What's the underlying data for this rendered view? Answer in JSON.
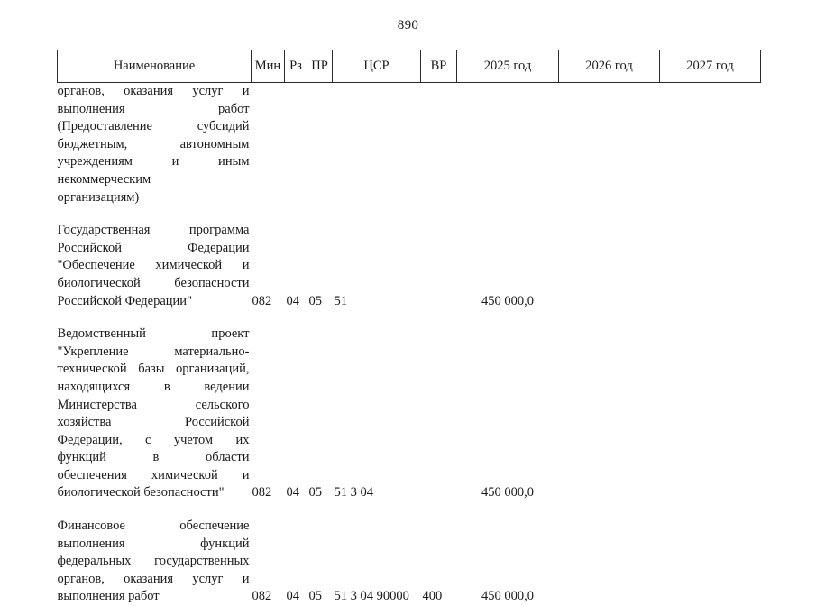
{
  "page": {
    "number": "890"
  },
  "table": {
    "headers": [
      {
        "key": "name",
        "label": "Наименование"
      },
      {
        "key": "min",
        "label": "Мин"
      },
      {
        "key": "rz",
        "label": "Рз"
      },
      {
        "key": "pr",
        "label": "ПР"
      },
      {
        "key": "csr",
        "label": "ЦСР"
      },
      {
        "key": "vr",
        "label": "ВР"
      },
      {
        "key": "y2025",
        "label": "2025 год"
      },
      {
        "key": "y2026",
        "label": "2026 год"
      },
      {
        "key": "y2027",
        "label": "2027 год"
      }
    ],
    "rows": [
      {
        "id": "row-continuation-subsidies",
        "name_lines": [
          "органов, оказания услуг и",
          "выполнения работ",
          "(Предоставление субсидий",
          "бюджетным, автономным",
          "учреждениям и иным",
          "некоммерческим",
          "организациям)"
        ],
        "name_full": "органов, оказания услуг и выполнения работ (Предоставление субсидий бюджетным, автономным учреждениям и иным некоммерческим организациям)",
        "min": "",
        "rz": "",
        "pr": "",
        "csr": "",
        "vr": "",
        "y2025": "",
        "y2026": "",
        "y2027": ""
      },
      {
        "id": "row-state-program-chem-bio-safety",
        "name_lines": [
          "Государственная программа",
          "Российской Федерации",
          "\"Обеспечение химической и",
          "биологической безопасности",
          "Российской Федерации\""
        ],
        "name_full": "Государственная программа Российской Федерации \"Обеспечение химической и биологической безопасности Российской Федерации\"",
        "min": "082",
        "rz": "04",
        "pr": "05",
        "csr": "51",
        "vr": "",
        "y2025": "450 000,0",
        "y2026": "",
        "y2027": ""
      },
      {
        "id": "row-departmental-project-material-base",
        "name_lines": [
          "Ведомственный проект",
          "\"Укрепление материально-",
          "технической базы организаций,",
          "находящихся в ведении",
          "Министерства сельского",
          "хозяйства Российской",
          "Федерации, с учетом их",
          "функций в области",
          "обеспечения химической и",
          "биологической безопасности\""
        ],
        "name_full": "Ведомственный проект \"Укрепление материально-технической базы организаций, находящихся в ведении Министерства сельского хозяйства Российской Федерации, с учетом их функций в области обеспечения химической и биологической безопасности\"",
        "min": "082",
        "rz": "04",
        "pr": "05",
        "csr": "51 3 04",
        "vr": "",
        "y2025": "450 000,0",
        "y2026": "",
        "y2027": ""
      },
      {
        "id": "row-financial-support-federal-bodies",
        "name_lines": [
          "Финансовое обеспечение",
          "выполнения функций",
          "федеральных государственных",
          "органов, оказания услуг и",
          "выполнения работ"
        ],
        "name_full": "Финансовое обеспечение выполнения функций федеральных государственных органов, оказания услуг и выполнения работ",
        "min": "082",
        "rz": "04",
        "pr": "05",
        "csr": "51 3 04 90000",
        "vr": "400",
        "y2025": "450 000,0",
        "y2026": "",
        "y2027": ""
      }
    ]
  }
}
